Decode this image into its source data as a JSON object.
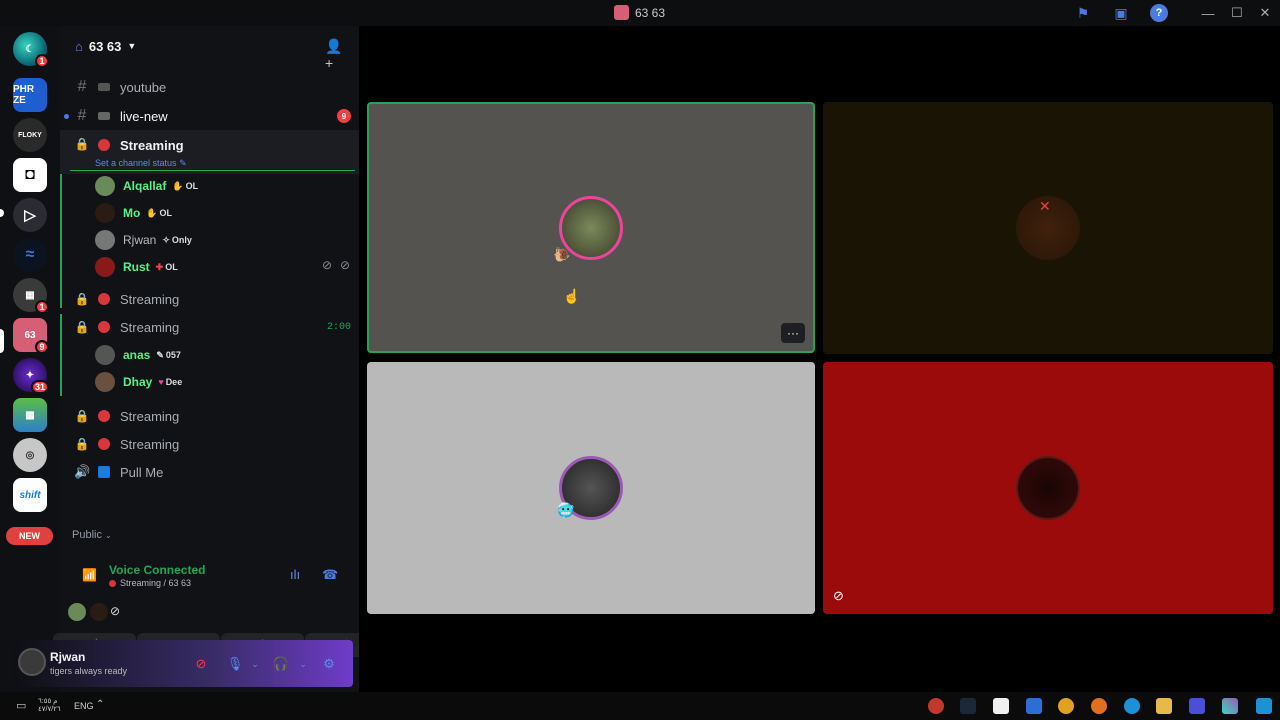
{
  "window": {
    "title": "63 63"
  },
  "guild": {
    "name": "63 63"
  },
  "server_rail": {
    "badges": [
      "1",
      "1",
      "9",
      "31"
    ],
    "new_label": "NEW",
    "server_texts": [
      "PHR ZE",
      "FLOKY",
      "shift",
      "63"
    ]
  },
  "channels": [
    {
      "name": "youtube",
      "type": "text",
      "emoji": "▤"
    },
    {
      "name": "live-new",
      "type": "text",
      "emoji": "▪",
      "unread_count": "9"
    },
    {
      "name": "Streaming",
      "type": "locked-voice",
      "emoji": "red-circle",
      "status_hint": "Set a channel status"
    },
    {
      "name": "Streaming",
      "type": "locked-voice",
      "emoji": "red-circle"
    },
    {
      "name": "Streaming",
      "type": "locked-voice",
      "emoji": "red-circle",
      "timer": "2:00"
    },
    {
      "name": "Streaming",
      "type": "locked-voice",
      "emoji": "red-circle"
    },
    {
      "name": "Streaming",
      "type": "locked-voice",
      "emoji": "red-circle"
    },
    {
      "name": "Pull Me",
      "type": "voice",
      "emoji": "blue-square"
    }
  ],
  "voice_users_1": [
    {
      "name": "Alqallaf",
      "tag": "OL",
      "color": "#57f287"
    },
    {
      "name": "Mo",
      "tag": "OL",
      "color": "#57f287"
    },
    {
      "name": "Rjwan",
      "tag": "Only",
      "color": "#b5bac1"
    },
    {
      "name": "Rust",
      "tag": "OL",
      "color": "#57f287"
    }
  ],
  "voice_users_2": [
    {
      "name": "anas",
      "tag": "057",
      "color": "#57f287"
    },
    {
      "name": "Dhay",
      "tag": "Dee",
      "color": "#57f287"
    }
  ],
  "category": {
    "public": "Public"
  },
  "voice_connected": {
    "title": "Voice Connected",
    "subtitle": "Streaming / 63 63"
  },
  "user_panel": {
    "name": "Rjwan",
    "status": "tigers always ready"
  },
  "stage_tiles": [
    {
      "bg": "#55534f",
      "speaking": true
    },
    {
      "bg": "#1a1405",
      "speaking": false
    },
    {
      "bg": "#b9b9b9",
      "speaking": false
    },
    {
      "bg": "#9c0b0b",
      "speaking": false
    }
  ],
  "taskbar": {
    "lang": "ENG",
    "clock_time": "م ٦:٥٥",
    "clock_date": "٤٧/٧/٢٦"
  },
  "colors": {
    "accent": "#5b8cf0",
    "voice_green": "#23a559",
    "danger": "#f23f43"
  }
}
